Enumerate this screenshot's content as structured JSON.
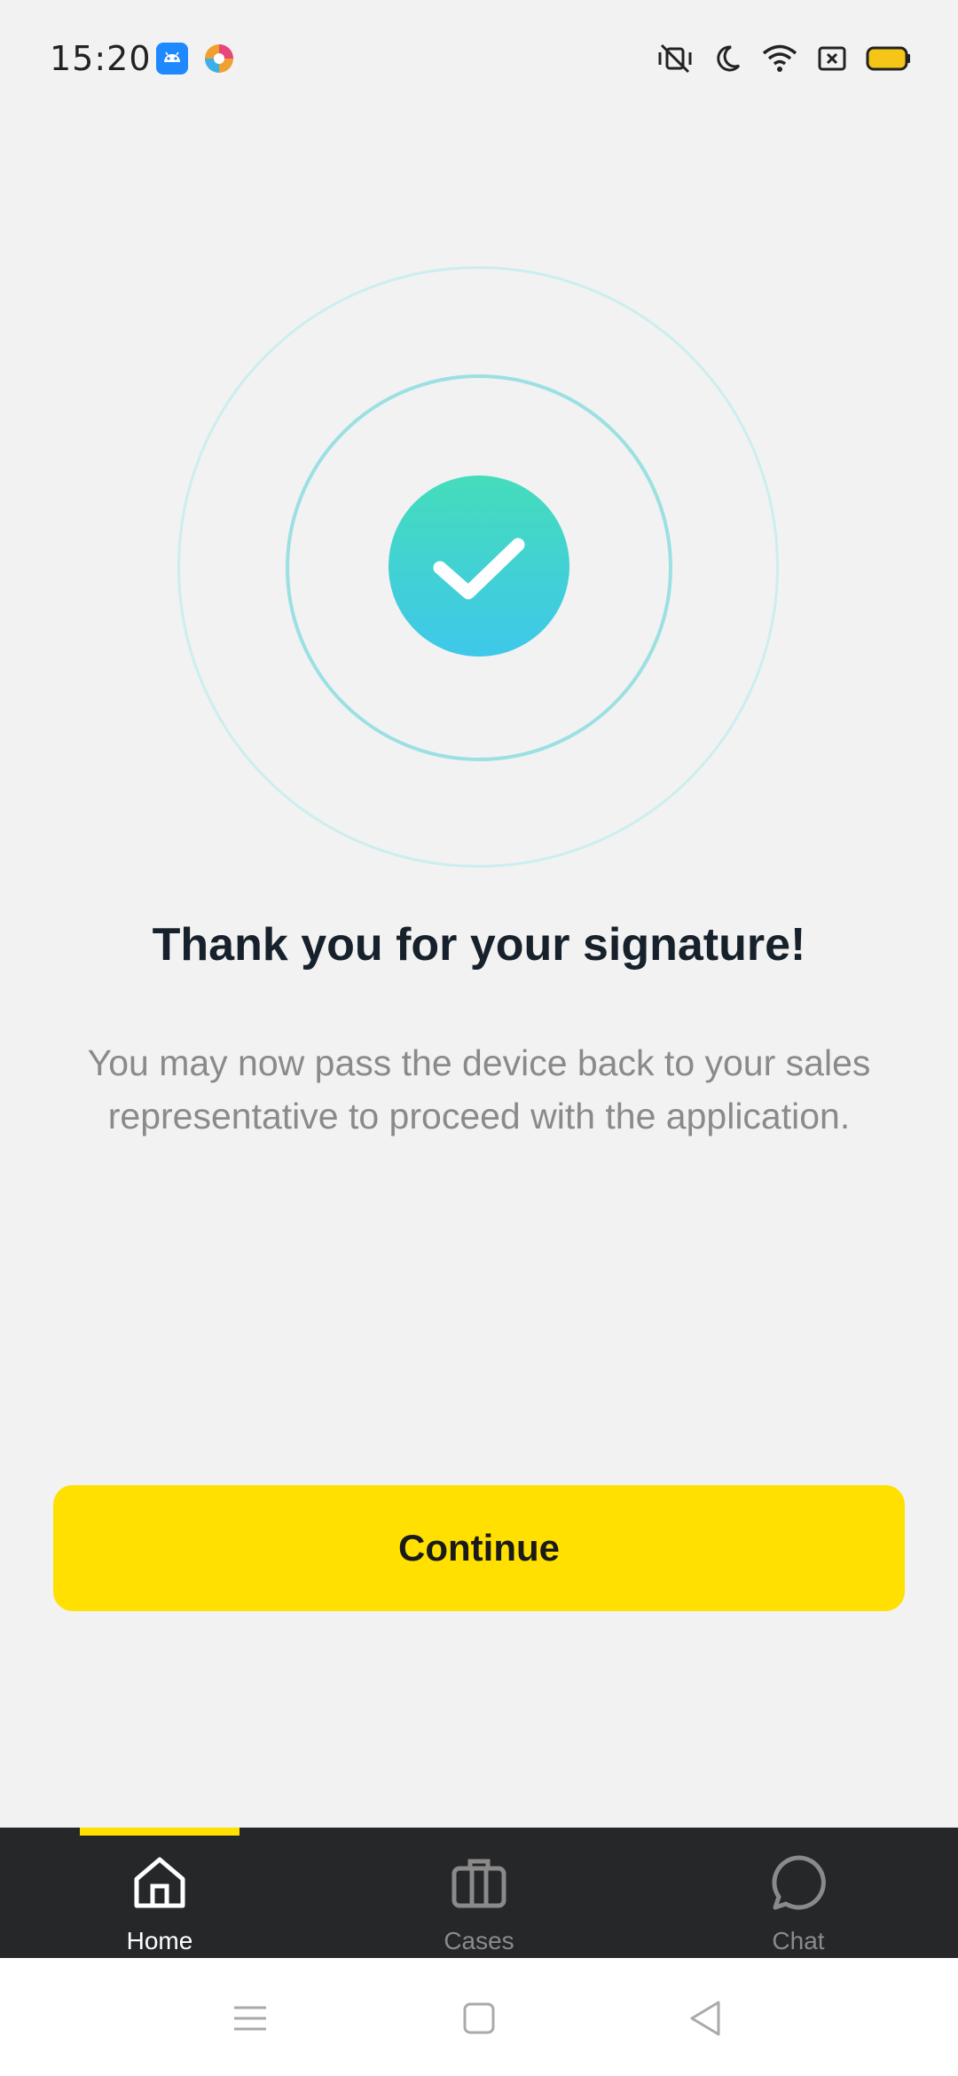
{
  "status_bar": {
    "time": "15:20",
    "icons": [
      "android-app-icon",
      "browser-app-icon",
      "vibrate-mute-icon",
      "do-not-disturb-icon",
      "wifi-icon",
      "sim-icon",
      "battery-icon"
    ],
    "battery_color": "#f5c518"
  },
  "success": {
    "icon": "checkmark-icon",
    "title": "Thank you for your signature!",
    "message": "You may now pass the device back to your sales representative to proceed with the application."
  },
  "actions": {
    "continue_label": "Continue"
  },
  "tab_bar": {
    "active": "Home",
    "tabs": [
      {
        "label": "Home",
        "icon": "home-icon"
      },
      {
        "label": "Cases",
        "icon": "briefcase-icon"
      },
      {
        "label": "Chat",
        "icon": "chat-bubble-icon"
      }
    ]
  },
  "system_nav": {
    "buttons": [
      "menu-icon",
      "home-square-icon",
      "back-triangle-icon"
    ]
  },
  "colors": {
    "accent": "#ffe000",
    "tab_bar_bg": "#262729",
    "success_gradient_top": "#45dcbb",
    "success_gradient_bottom": "#3ec8ea"
  }
}
